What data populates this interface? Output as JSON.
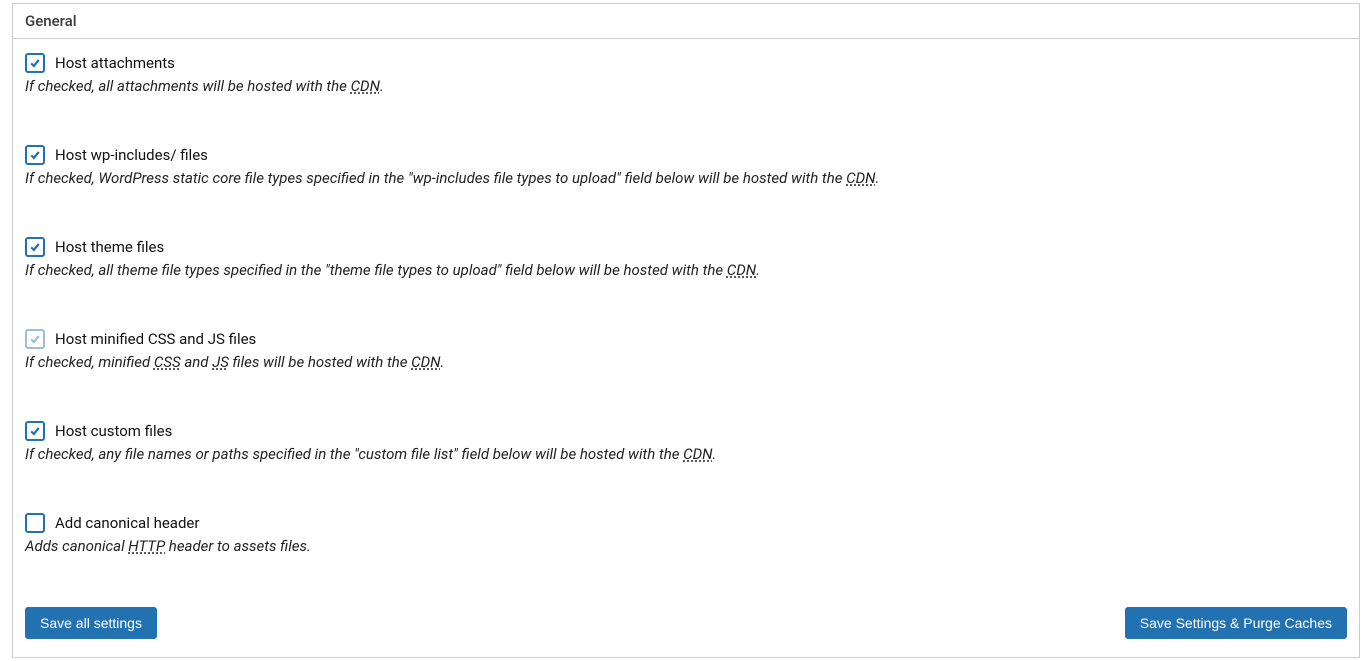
{
  "panel": {
    "title": "General",
    "settings": [
      {
        "id": "host-attachments",
        "checked": true,
        "disabled": false,
        "label": "Host attachments",
        "desc": [
          {
            "t": "If checked, all attachments will be hosted with the "
          },
          {
            "t": "CDN",
            "abbr": true
          },
          {
            "t": "."
          }
        ]
      },
      {
        "id": "host-wp-includes",
        "checked": true,
        "disabled": false,
        "label": "Host wp-includes/ files",
        "desc": [
          {
            "t": "If checked, WordPress static core file types specified in the \"wp-includes file types to upload\" field below will be hosted with the "
          },
          {
            "t": "CDN",
            "abbr": true
          },
          {
            "t": "."
          }
        ]
      },
      {
        "id": "host-theme-files",
        "checked": true,
        "disabled": false,
        "label": "Host theme files",
        "desc": [
          {
            "t": "If checked, all theme file types specified in the \"theme file types to upload\" field below will be hosted with the "
          },
          {
            "t": "CDN",
            "abbr": true
          },
          {
            "t": "."
          }
        ]
      },
      {
        "id": "host-minified",
        "checked": true,
        "disabled": true,
        "labelSegs": [
          {
            "t": "Host minified "
          },
          {
            "t": "CSS",
            "abbr": true
          },
          {
            "t": " and "
          },
          {
            "t": "JS",
            "abbr": true
          },
          {
            "t": " files"
          }
        ],
        "desc": [
          {
            "t": "If checked, minified "
          },
          {
            "t": "CSS",
            "abbr": true
          },
          {
            "t": " and "
          },
          {
            "t": "JS",
            "abbr": true
          },
          {
            "t": " files will be hosted with the "
          },
          {
            "t": "CDN",
            "abbr": true
          },
          {
            "t": "."
          }
        ]
      },
      {
        "id": "host-custom-files",
        "checked": true,
        "disabled": false,
        "label": "Host custom files",
        "desc": [
          {
            "t": "If checked, any file names or paths specified in the \"custom file list\" field below will be hosted with the "
          },
          {
            "t": "CDN",
            "abbr": true
          },
          {
            "t": "."
          }
        ]
      },
      {
        "id": "add-canonical-header",
        "checked": false,
        "disabled": false,
        "label": "Add canonical header",
        "desc": [
          {
            "t": "Adds canonical "
          },
          {
            "t": "HTTP",
            "abbr": true
          },
          {
            "t": " header to assets files."
          }
        ]
      }
    ],
    "buttons": {
      "save": "Save all settings",
      "savePurge": "Save Settings & Purge Caches"
    }
  }
}
